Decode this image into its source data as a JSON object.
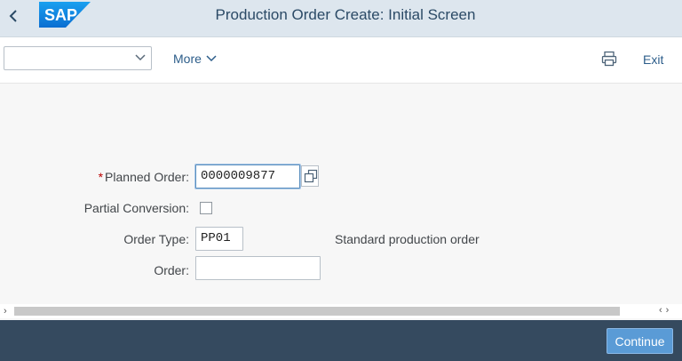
{
  "header": {
    "title": "Production Order Create: Initial Screen",
    "logo_text": "SAP",
    "back_icon": "chevron-left-icon"
  },
  "toolbar": {
    "command_value": "",
    "more_label": "More",
    "print_icon": "print-icon",
    "exit_label": "Exit"
  },
  "form": {
    "planned_order": {
      "required_mark": "*",
      "label": "Planned Order:",
      "value": "0000009877"
    },
    "partial_conversion": {
      "label": "Partial Conversion:",
      "checked": false
    },
    "order_type": {
      "label": "Order Type:",
      "value": "PP01",
      "description": "Standard production order"
    },
    "order": {
      "label": "Order:",
      "value": ""
    }
  },
  "scrollbar": {
    "left_arrow": "›",
    "right_arrows": "‹›"
  },
  "footer": {
    "continue_label": "Continue"
  },
  "colors": {
    "shell_bg": "#dde6ee",
    "footer_bg": "#354a5f",
    "button_bg": "#5a9bd6",
    "link": "#2c5d8a",
    "required": "#bb0000",
    "logo_blue": "#0a6ed1"
  }
}
